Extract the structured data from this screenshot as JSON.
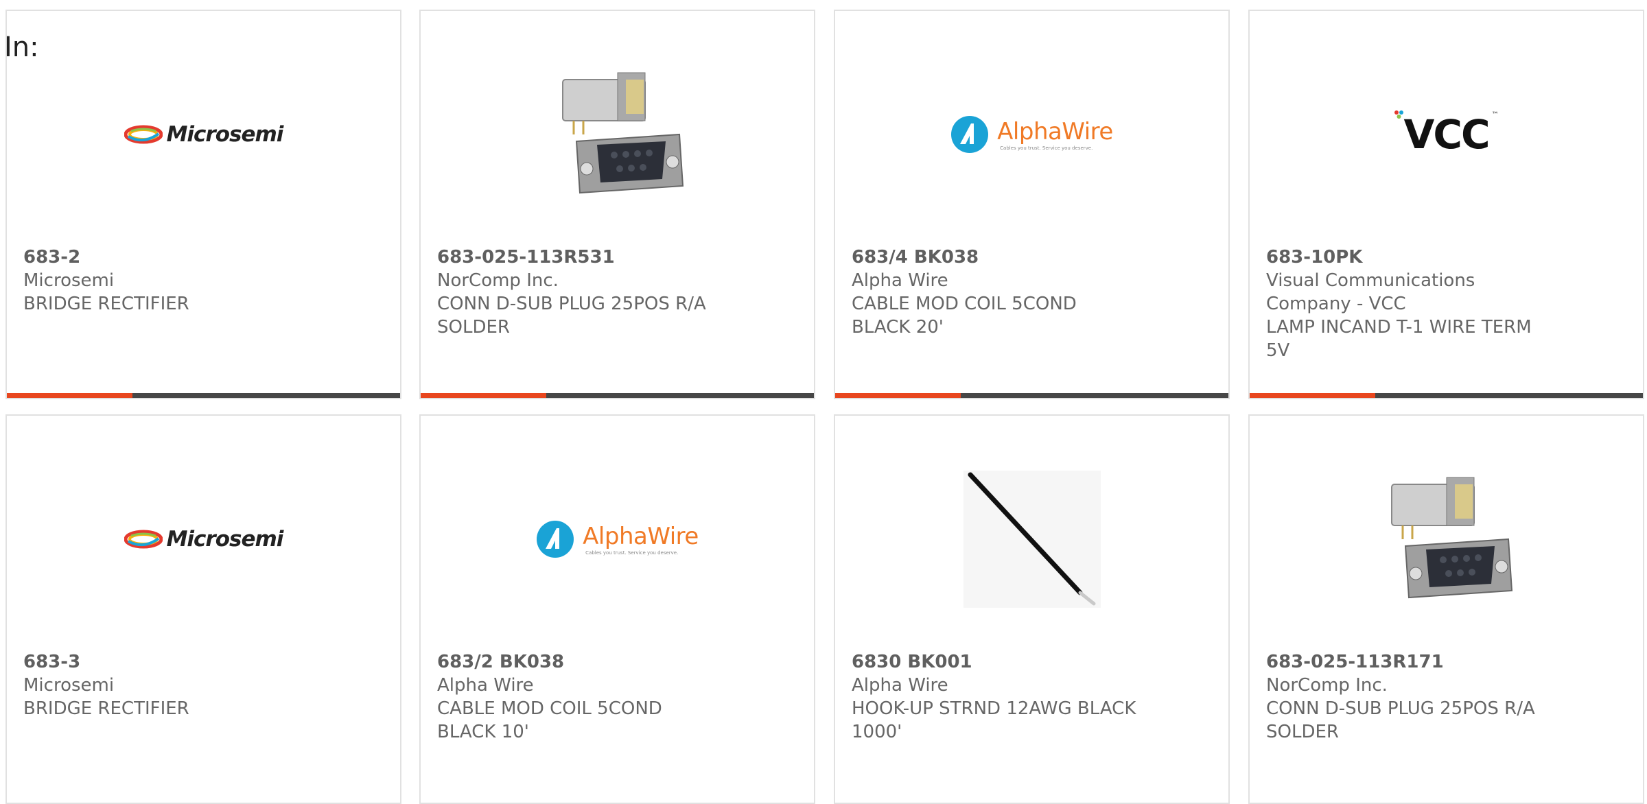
{
  "prefix_label": "In:",
  "colors": {
    "accent": "#e8461e",
    "bar": "#464646",
    "border": "#e1e1e1",
    "vcc_dots": [
      "#e43a2e",
      "#19a5d8",
      "#8bc34a"
    ]
  },
  "products": [
    {
      "part_number": "683-2",
      "manufacturer": "Microsemi",
      "description": "BRIDGE RECTIFIER",
      "image": "microsemi-logo"
    },
    {
      "part_number": "683-025-113R531",
      "manufacturer": "NorComp Inc.",
      "description": "CONN D-SUB PLUG 25POS R/A SOLDER",
      "image": "dsub-connector-photo"
    },
    {
      "part_number": "683/4 BK038",
      "manufacturer": "Alpha Wire",
      "description": "CABLE MOD COIL 5COND BLACK 20'",
      "image": "alphawire-logo"
    },
    {
      "part_number": "683-10PK",
      "manufacturer": "Visual Communications Company - VCC",
      "description": "LAMP INCAND T-1 WIRE TERM 5V",
      "image": "vcc-logo"
    },
    {
      "part_number": "683-3",
      "manufacturer": "Microsemi",
      "description": "BRIDGE RECTIFIER",
      "image": "microsemi-logo"
    },
    {
      "part_number": "683/2 BK038",
      "manufacturer": "Alpha Wire",
      "description": "CABLE MOD COIL 5COND BLACK 10'",
      "image": "alphawire-logo"
    },
    {
      "part_number": "6830 BK001",
      "manufacturer": "Alpha Wire",
      "description": "HOOK-UP STRND 12AWG BLACK 1000'",
      "image": "black-wire-photo"
    },
    {
      "part_number": "683-025-113R171",
      "manufacturer": "NorComp Inc.",
      "description": "CONN D-SUB PLUG 25POS R/A SOLDER",
      "image": "dsub-connector-photo"
    }
  ],
  "logos": {
    "microsemi": "Microsemi",
    "alphawire": "AlphaWire",
    "alphawire_tagline": "Cables you trust. Service you deserve.",
    "vcc": "VCC",
    "vcc_tm": "™"
  }
}
